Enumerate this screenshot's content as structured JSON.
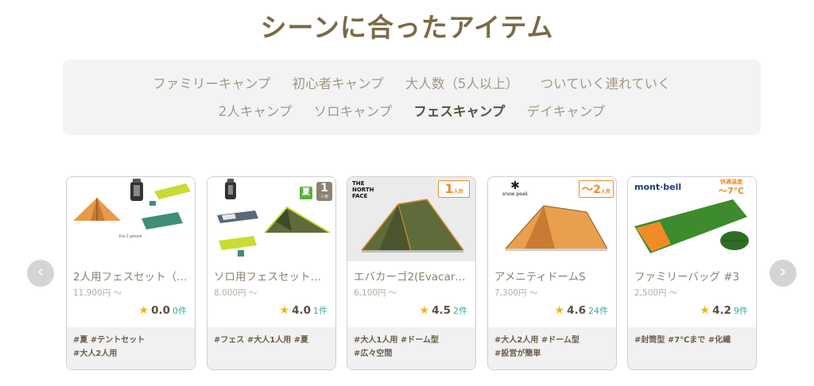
{
  "title": "シーンに合ったアイテム",
  "scenes": {
    "row1": [
      "ファミリーキャンプ",
      "初心者キャンプ",
      "大人数（5人以上）",
      "ついていく連れていく"
    ],
    "row2": [
      "2人キャンプ",
      "ソロキャンプ",
      "フェスキャンプ",
      "デイキャンプ"
    ],
    "active": "フェスキャンプ"
  },
  "nav": {
    "prev_icon": "‹",
    "next_icon": "›"
  },
  "cards": [
    {
      "name": "2人用フェスセット（…",
      "price": "11,900円 ～",
      "score": "0.0",
      "count": "0件",
      "tags": [
        "#夏 #テントセット",
        "#大人2人用"
      ],
      "image_caption": "For 2 person"
    },
    {
      "name": "ソロ用フェスセット（…",
      "price": "8,000円 ～",
      "score": "4.0",
      "count": "1件",
      "tags": [
        "#フェス #大人1人用 #夏"
      ],
      "badge_season": "夏",
      "badge_persons": "1",
      "badge_unit": "人用"
    },
    {
      "name": "エバカーゴ2(Evacarg…",
      "price": "6,100円 ～",
      "score": "4.5",
      "count": "2件",
      "tags": [
        "#大人1人用 #ドーム型",
        "#広々空間"
      ],
      "brand": "THE NORTH FACE",
      "badge_persons": "1",
      "badge_unit": "人用"
    },
    {
      "name": "アメニティドームS",
      "price": "7,300円 ～",
      "score": "4.6",
      "count": "24件",
      "tags": [
        "#大人2人用 #ドーム型",
        "#設営が簡単"
      ],
      "brand": "snow peak",
      "badge_persons": "～2",
      "badge_unit": "人用"
    },
    {
      "name": "ファミリーバッグ #3",
      "price": "2,500円 ～",
      "score": "4.2",
      "count": "9件",
      "tags": [
        "#封筒型 #7℃まで #化繊"
      ],
      "brand": "mont·bell",
      "temp_label": "快適温度",
      "temp_value": "～7℃"
    }
  ],
  "colors": {
    "title": "#7c6a45",
    "accent_orange": "#f08c28",
    "rating_star": "#f4b400",
    "review_count": "#3aa7a0",
    "tent_orange": "#e89a4a",
    "tent_olive": "#5f6b3a",
    "sleeping_bag_green": "#3e8a2e"
  },
  "icons": [
    "star-icon",
    "chevron-left-icon",
    "chevron-right-icon",
    "lantern-icon",
    "tent-icon",
    "sleeping-mat-icon",
    "sleeping-bag-icon"
  ]
}
